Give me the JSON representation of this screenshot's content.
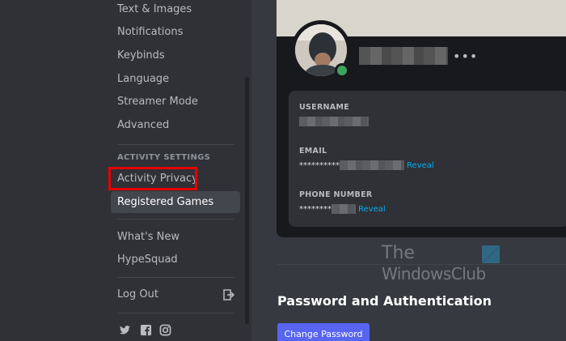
{
  "sidebar": {
    "items_top": [
      {
        "label": "Text & Images"
      },
      {
        "label": "Notifications"
      },
      {
        "label": "Keybinds"
      },
      {
        "label": "Language"
      },
      {
        "label": "Streamer Mode"
      },
      {
        "label": "Advanced"
      }
    ],
    "activity_header": "ACTIVITY SETTINGS",
    "activity_items": [
      {
        "label": "Activity Privacy"
      },
      {
        "label": "Registered Games"
      }
    ],
    "misc_items": [
      {
        "label": "What's New"
      },
      {
        "label": "HypeSquad"
      }
    ],
    "logout_label": "Log Out",
    "social_icons": [
      "twitter-icon",
      "facebook-icon",
      "instagram-icon"
    ]
  },
  "account": {
    "username_label": "USERNAME",
    "email_label": "EMAIL",
    "email_masked": "**********",
    "email_reveal": "Reveal",
    "phone_label": "PHONE NUMBER",
    "phone_masked": "********",
    "phone_reveal": "Reveal"
  },
  "watermark": {
    "line1": "The",
    "line2": "WindowsClub"
  },
  "password_section": {
    "title": "Password and Authentication",
    "change_button": "Change Password"
  },
  "colors": {
    "accent": "#5865f2",
    "link": "#00aff4",
    "online": "#3ba55d",
    "highlight": "#e60000"
  }
}
